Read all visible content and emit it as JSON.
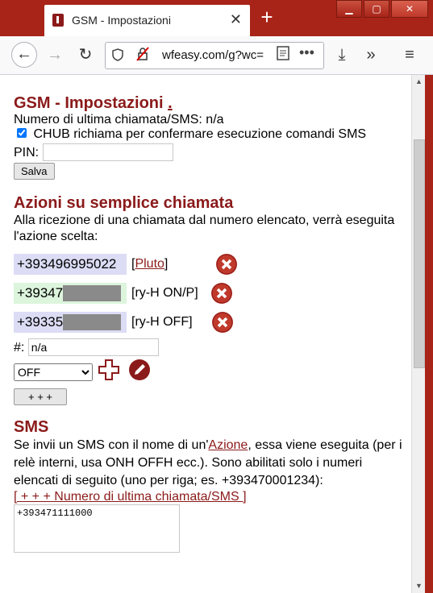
{
  "window": {
    "tab_title": "GSM - Impostazioni",
    "close_tab": "✕",
    "new_tab": "+",
    "minimize": "▁",
    "maximize": "▢",
    "close": "✕"
  },
  "navbar": {
    "url": "wfeasy.com/g?wc=",
    "back": "←",
    "forward": "→",
    "reload": "↻",
    "more": "•••",
    "download": "⤓",
    "overflow": "»",
    "menu": "≡"
  },
  "gsm": {
    "title": "GSM - Impostazioni",
    "title_link": ".",
    "last_call_label": "Numero di ultima chiamata/SMS: n/a",
    "confirm_checkbox_label": "CHUB richiama per confermare esecuzione comandi SMS",
    "pin_label": "PIN:",
    "pin_value": "",
    "save_label": "Salva"
  },
  "actions": {
    "title": "Azioni su semplice chiamata",
    "description": "Alla ricezione di una chiamata dal numero elencato, verrà eseguita l'azione scelta:",
    "rows": [
      {
        "number": "+393496995022",
        "action_link": "Pluto",
        "bg": "#dcdcf5"
      },
      {
        "number": "+39347",
        "action": "[ry-H ON/P]",
        "bg": "#dcf5dc"
      },
      {
        "number": "+39335",
        "action": "[ry-H OFF]",
        "bg": "#dcdcf5"
      }
    ],
    "hash_label": "#:",
    "hash_value": "n/a",
    "select_value": "OFF",
    "add_label": "+ + +"
  },
  "sms": {
    "title": "SMS",
    "desc_before": "Se invii un SMS con il nome di un'",
    "desc_link": "Azione",
    "desc_after": ", essa viene eseguita (per i relè interni, usa ONH OFFH ecc.). Sono abilitati solo i numeri elencati di seguito (uno per riga; es. +393470001234):",
    "add_last_link": "[ + + + Numero di ultima chiamata/SMS ]",
    "textarea_value": "+393471111000"
  },
  "colors": {
    "accent": "#8b1a1a",
    "titlebar": "#a82418"
  }
}
